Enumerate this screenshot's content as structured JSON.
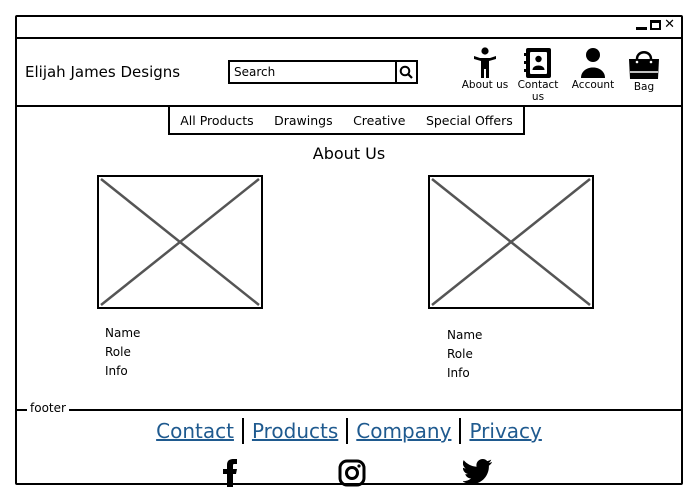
{
  "brand": {
    "name": "Elijah James Designs"
  },
  "search": {
    "placeholder": "Search"
  },
  "nav_icons": [
    {
      "label": "About us",
      "icon": "person-icon"
    },
    {
      "label": "Contact us",
      "icon": "contact-book-icon"
    },
    {
      "label": "Account",
      "icon": "user-icon"
    },
    {
      "label": "Bag",
      "icon": "shopping-bag-icon"
    }
  ],
  "menu": {
    "items": [
      "All Products",
      "Drawings",
      "Creative",
      "Special Offers"
    ]
  },
  "page": {
    "title": "About Us"
  },
  "cards": [
    {
      "name": "Name",
      "role": "Role",
      "info": "Info"
    },
    {
      "name": "Name",
      "role": "Role",
      "info": "Info"
    }
  ],
  "footer": {
    "label": "footer",
    "links": [
      "Contact",
      "Products",
      "Company",
      "Privacy"
    ],
    "link_color": "#1f5a8f",
    "social": [
      "facebook-icon",
      "instagram-icon",
      "twitter-icon"
    ]
  }
}
